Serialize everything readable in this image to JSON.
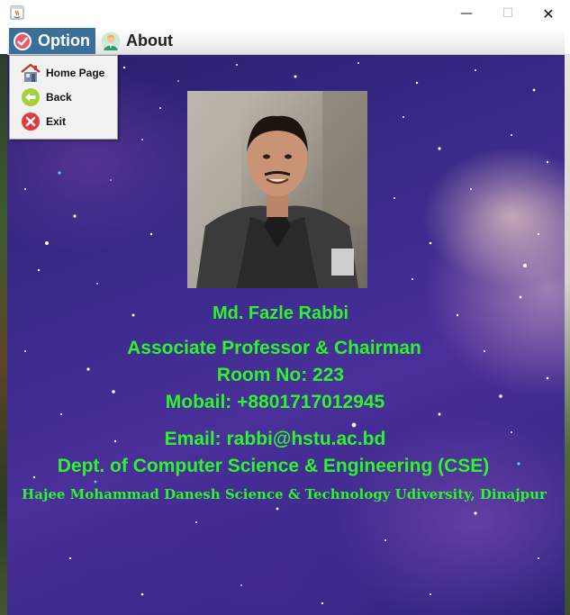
{
  "window": {
    "close_glyph": "✕",
    "minimize_glyph": "—",
    "maximize_glyph": "☐"
  },
  "menubar": {
    "option_label": "Option",
    "about_label": "About",
    "option_icon": "check-circle-icon",
    "about_icon": "person-icon"
  },
  "option_menu": {
    "items": [
      {
        "label": "Home Page",
        "icon": "home-icon"
      },
      {
        "label": "Back",
        "icon": "back-arrow-icon"
      },
      {
        "label": "Exit",
        "icon": "exit-x-icon"
      }
    ]
  },
  "profile": {
    "name": "Md. Fazle Rabbi",
    "title": "Associate Professor & Chairman",
    "room": "Room No: 223",
    "mobile": "Mobail: +8801717012945",
    "email": "Email: rabbi@hstu.ac.bd",
    "department": "Dept. of Computer Science & Engineering (CSE)",
    "university": "Hajee Mohammad Danesh Science & Technology Udiversity, Dinajpur"
  },
  "colors": {
    "text_accent": "#2bf52b",
    "menu_selected": "#3b6f9a",
    "background_space": "#3a2a8a"
  }
}
